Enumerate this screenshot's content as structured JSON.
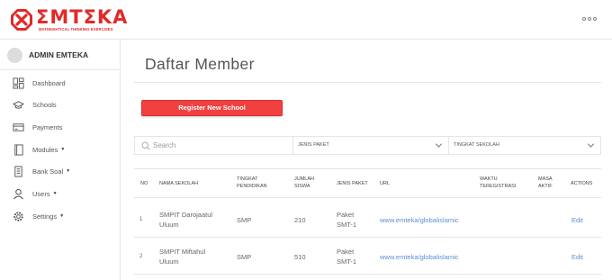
{
  "brand": {
    "name": "ΣMTΣKA",
    "tagline": "MATHEMATICAL THINKING EXERCISES",
    "color": "#e02a2a"
  },
  "topbar": {
    "menu_icon": "more-horizontal-icon"
  },
  "user": {
    "name": "ADMIN EMTEKA"
  },
  "nav": [
    {
      "label": "Dashboard",
      "icon": "dashboard-icon",
      "dropdown": false
    },
    {
      "label": "Schools",
      "icon": "graduation-cap-icon",
      "dropdown": false
    },
    {
      "label": "Payments",
      "icon": "credit-card-icon",
      "dropdown": false
    },
    {
      "label": "Modules",
      "icon": "book-icon",
      "dropdown": true
    },
    {
      "label": "Bank Soal",
      "icon": "document-icon",
      "dropdown": true
    },
    {
      "label": "Users",
      "icon": "user-icon",
      "dropdown": true
    },
    {
      "label": "Settings",
      "icon": "gear-icon",
      "dropdown": true
    }
  ],
  "page": {
    "title": "Daftar Member",
    "register_button": "Register New School",
    "accent_color": "#f04040"
  },
  "filters": {
    "search_placeholder": "Search",
    "jenis_paket": "JENIS PAKET",
    "tingkat_sekolah": "TINGKAT SEKOLAH"
  },
  "table": {
    "headers": {
      "no": "NO",
      "nama_sekolah": "NAMA SEKOLAH",
      "tingkat_line1": "TINGKAT",
      "tingkat_line2": "PENDIDIKAN",
      "jumlah_line1": "JUMLAH",
      "jumlah_line2": "SISWA",
      "jenis_paket": "JENIS PAKET",
      "url": "URL",
      "waktu_line1": "WAKTU",
      "waktu_line2": "TEREGISTRASI",
      "masa_line1": "MASA",
      "masa_line2": "AKTIF",
      "actions": "ACTIONS"
    },
    "rows": [
      {
        "no": "1",
        "nama_line1": "SMPIT Darojaatul",
        "nama_line2": "Uluum",
        "tingkat": "SMP",
        "jumlah": "210",
        "paket_line1": "Paket",
        "paket_line2": "SMT-1",
        "url": "www.emteka/globalislamic",
        "waktu": "",
        "masa": "",
        "action": "Edit"
      },
      {
        "no": "2",
        "nama_line1": "SMPIT Miftahul",
        "nama_line2": "Uluum",
        "tingkat": "SMP",
        "jumlah": "510",
        "paket_line1": "Paket",
        "paket_line2": "SMT-1",
        "url": "www.emteka/globalislamic",
        "waktu": "",
        "masa": "",
        "action": "Edit"
      }
    ]
  }
}
